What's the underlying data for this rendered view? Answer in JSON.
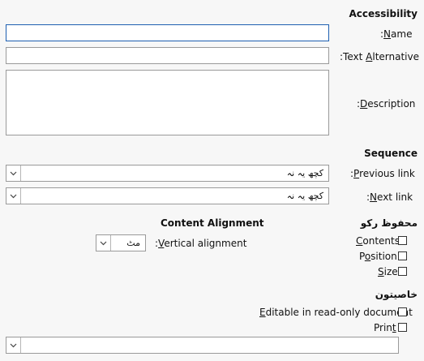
{
  "accessibility": {
    "heading": "Accessibility",
    "name_label_pre": ":",
    "name_label_u": "N",
    "name_label_post": "ame",
    "name_value": "",
    "alt_label_pre": ":Text ",
    "alt_label_u": "A",
    "alt_label_post": "lternative",
    "alt_value": "",
    "desc_label_pre": ":",
    "desc_label_u": "D",
    "desc_label_post": "escription",
    "desc_value": ""
  },
  "sequence": {
    "heading": "Sequence",
    "prev_label_pre": ":",
    "prev_label_u": "P",
    "prev_label_post": "revious link",
    "prev_value": "کچھ یہ نہ",
    "next_label_pre": ":",
    "next_label_u": "N",
    "next_label_post": "ext link",
    "next_value": "کچھ یہ نہ"
  },
  "protect": {
    "heading": "محفوظ رکو",
    "contents_u": "C",
    "contents_post": "ontents",
    "position_pre": "P",
    "position_u": "o",
    "position_post": "sition",
    "size_u": "S",
    "size_post": "ize"
  },
  "content_alignment": {
    "heading": "Content Alignment",
    "label_pre": ":",
    "label_u": "V",
    "label_post": "ertical alignment",
    "value": "مٹ"
  },
  "properties": {
    "heading": "خاصیتون",
    "editable_u": "E",
    "editable_post": "ditable in read-only document",
    "print_pre": "Prin",
    "print_u": "t",
    "bottom_value": ""
  },
  "icons": {
    "dropdown": "chevron-down-icon"
  }
}
